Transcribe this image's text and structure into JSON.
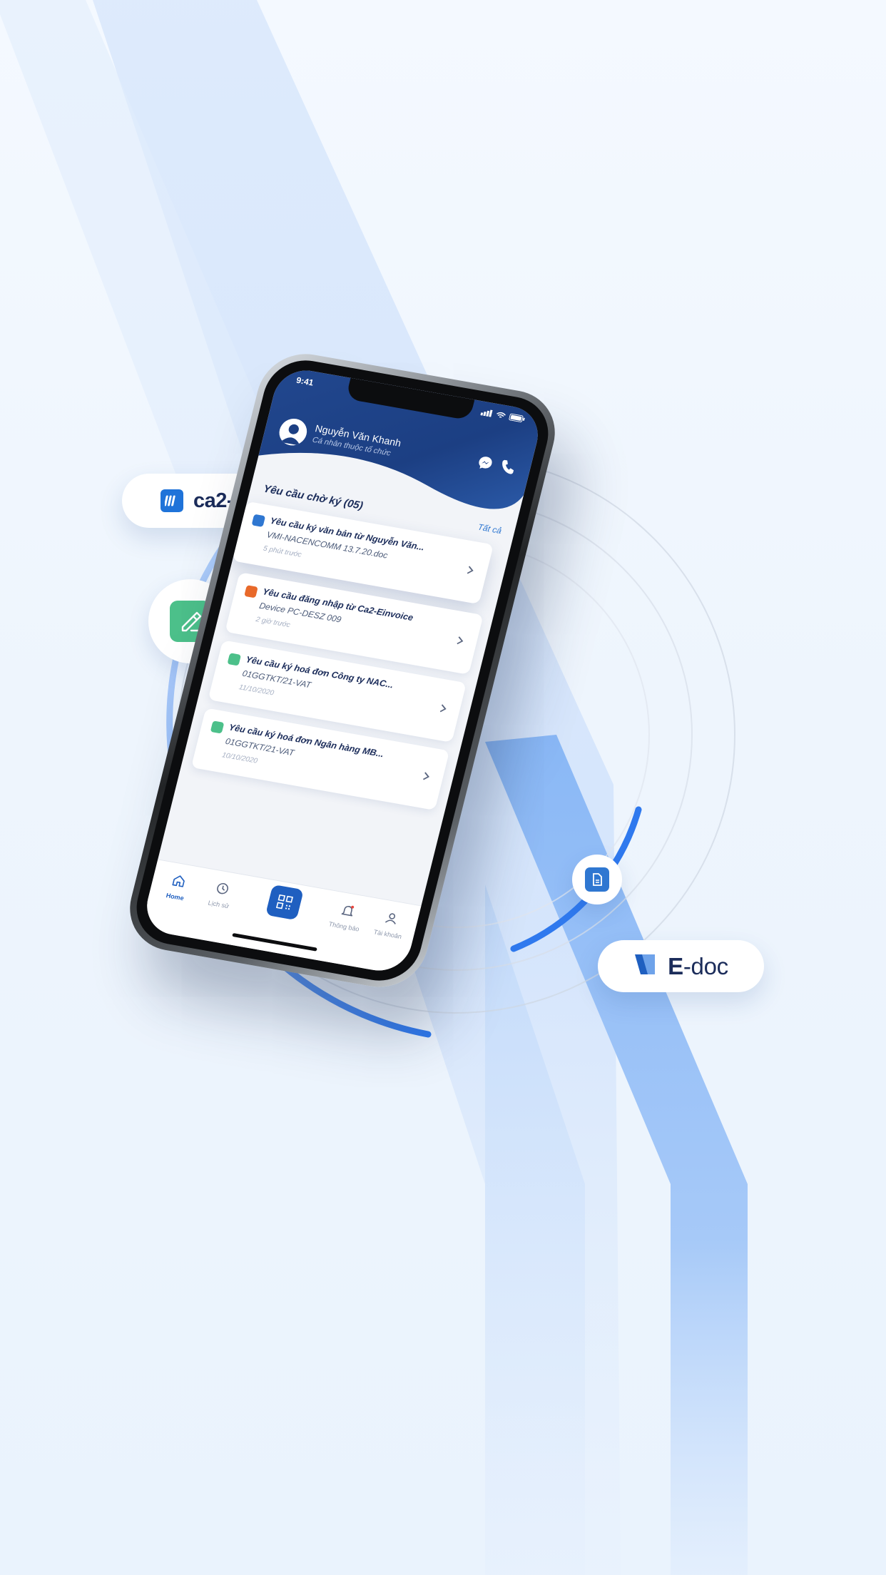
{
  "brands": {
    "einvoice_name": "ca2-einvoice",
    "edoc_prefix": "E",
    "edoc_suffix": "-doc"
  },
  "phone": {
    "status_time": "9:41",
    "user_name": "Nguyễn Văn Khanh",
    "user_sub": "Cá nhân thuộc tổ chức",
    "section_title": "Yêu cầu chờ ký (05)",
    "section_all": "Tất cả",
    "requests": [
      {
        "title": "Yêu cầu ký văn bản từ Nguyễn Văn...",
        "detail": "VMI-NACENCOMM 13.7.20.doc",
        "meta": "5 phút trước",
        "icon": "document-icon",
        "color": "#2f77d1"
      },
      {
        "title": "Yêu cầu đăng nhập từ Ca2-Einvoice",
        "detail": "Device PC-DESZ 009",
        "meta": "2 giờ trước",
        "icon": "login-icon",
        "color": "#e8692a"
      },
      {
        "title": "Yêu cầu ký hoá đơn Công ty NAC...",
        "detail": "01GGTKT/21-VAT",
        "meta": "11/10/2020",
        "icon": "pen-icon",
        "color": "#4cc08a"
      },
      {
        "title": "Yêu cầu ký hoá đơn Ngân hàng MB...",
        "detail": "01GGTKT/21-VAT",
        "meta": "10/10/2020",
        "icon": "pen-icon",
        "color": "#4cc08a"
      }
    ],
    "tabs": [
      {
        "label": "Home",
        "icon": "home-icon",
        "active": true
      },
      {
        "label": "Lịch sử",
        "icon": "clock-icon"
      },
      {
        "label": "",
        "icon": "qr-scan-icon"
      },
      {
        "label": "Thông báo",
        "icon": "bell-icon"
      },
      {
        "label": "Tài khoản",
        "icon": "user-icon"
      }
    ]
  },
  "colors": {
    "primary": "#1f5fc0",
    "header": "#1c3f83",
    "green": "#4cc08a",
    "orange": "#e8692a",
    "text": "#1b2c5a"
  }
}
